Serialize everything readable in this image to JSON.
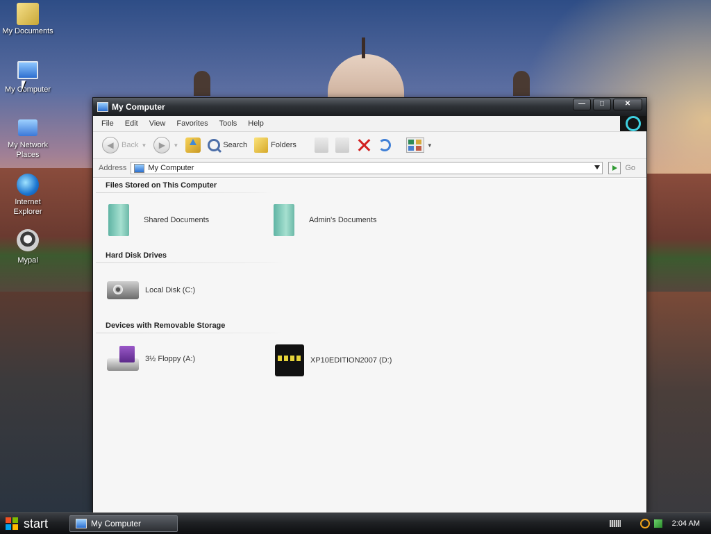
{
  "desktop": {
    "icons": [
      {
        "label": "My Documents",
        "icon": "my-documents-icon"
      },
      {
        "label": "My Computer",
        "icon": "my-computer-icon"
      },
      {
        "label": "My Network Places",
        "icon": "network-places-icon"
      },
      {
        "label": "Internet Explorer",
        "icon": "internet-explorer-icon"
      },
      {
        "label": "Mypal",
        "icon": "mypal-icon"
      }
    ]
  },
  "window": {
    "title": "My Computer",
    "controls": {
      "minimize": "—",
      "maximize": "□",
      "close": "✕"
    },
    "menu": [
      "File",
      "Edit",
      "View",
      "Favorites",
      "Tools",
      "Help"
    ],
    "toolbar": {
      "back_label": "Back",
      "search_label": "Search",
      "folders_label": "Folders"
    },
    "address": {
      "label": "Address",
      "value": "My Computer",
      "go_label": "Go"
    },
    "groups": [
      {
        "header": "Files Stored on This Computer",
        "items": [
          {
            "label": "Shared Documents",
            "icon": "shared-documents-icon"
          },
          {
            "label": "Admin's Documents",
            "icon": "admin-documents-icon"
          }
        ]
      },
      {
        "header": "Hard Disk Drives",
        "items": [
          {
            "label": "Local Disk (C:)",
            "icon": "hard-disk-icon"
          }
        ]
      },
      {
        "header": "Devices with Removable Storage",
        "items": [
          {
            "label": "3½ Floppy (A:)",
            "icon": "floppy-drive-icon"
          },
          {
            "label": "XP10EDITION2007 (D:)",
            "icon": "cd-drive-icon"
          }
        ]
      }
    ]
  },
  "taskbar": {
    "start_label": "start",
    "tasks": [
      {
        "label": "My Computer"
      }
    ],
    "clock": "2:04 AM"
  },
  "colors": {
    "titlebar": "#2f3338",
    "window_bg": "#f6f6f6",
    "taskbar": "#1f2124",
    "delete_red": "#d21f1f"
  }
}
